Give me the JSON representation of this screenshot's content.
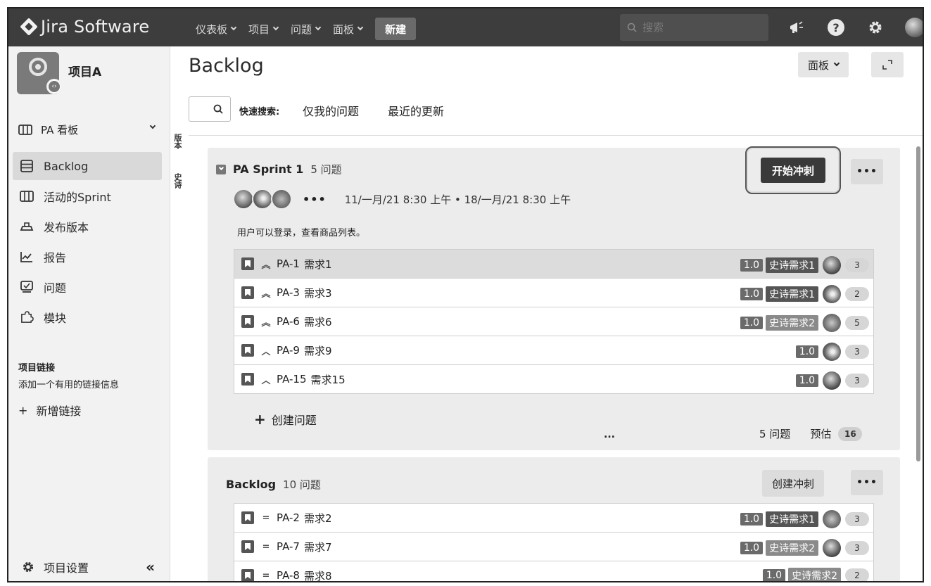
{
  "topbar": {
    "logo_text": "Jira Software",
    "nav": [
      {
        "label": "仪表板"
      },
      {
        "label": "项目"
      },
      {
        "label": "问题"
      },
      {
        "label": "面板"
      }
    ],
    "create_label": "新建",
    "search_placeholder": "搜索",
    "icons": [
      "notifications-icon",
      "help-icon",
      "settings-icon",
      "profile-avatar"
    ]
  },
  "sidebar": {
    "project_name": "项目A",
    "board_selector": "PA 看板",
    "items": [
      {
        "label": "Backlog",
        "icon": "backlog-icon",
        "active": true
      },
      {
        "label": "活动的Sprint",
        "icon": "board-icon",
        "active": false
      },
      {
        "label": "发布版本",
        "icon": "ship-icon",
        "active": false
      },
      {
        "label": "报告",
        "icon": "chart-icon",
        "active": false
      },
      {
        "label": "问题",
        "icon": "issues-icon",
        "active": false
      },
      {
        "label": "模块",
        "icon": "puzzle-icon",
        "active": false
      }
    ],
    "links_title": "项目链接",
    "links_desc": "添加一个有用的链接信息",
    "add_link": "新增链接",
    "settings_label": "项目设置",
    "collapse_label": "«"
  },
  "vtabs": [
    "版本",
    "史诗"
  ],
  "main": {
    "title": "Backlog",
    "board_button": "面板",
    "quick_search_label": "快速搜索:",
    "quick_filters": [
      "仅我的问题",
      "最近的更新"
    ]
  },
  "sprint": {
    "name": "PA Sprint 1",
    "count": "5 问题",
    "more": "•••",
    "dates": "11/一月/21 8:30 上午 • 18/一月/21 8:30 上午",
    "goal": "用户可以登录，查看商品列表。",
    "start_button": "开始冲刺",
    "issues": [
      {
        "key": "PA-1",
        "summary": "需求1",
        "priority": "︽",
        "version": "1.0",
        "epic": "史诗需求1",
        "points": "3"
      },
      {
        "key": "PA-3",
        "summary": "需求3",
        "priority": "︽",
        "version": "1.0",
        "epic": "史诗需求1",
        "points": "2"
      },
      {
        "key": "PA-6",
        "summary": "需求6",
        "priority": "︽",
        "version": "1.0",
        "epic": "史诗需求2",
        "points": "5"
      },
      {
        "key": "PA-9",
        "summary": "需求9",
        "priority": "︿",
        "version": "1.0",
        "epic": "",
        "points": "3"
      },
      {
        "key": "PA-15",
        "summary": "需求15",
        "priority": "︿",
        "version": "1.0",
        "epic": "",
        "points": "3"
      }
    ],
    "create_issue": "创建问题",
    "footer_dots": "...",
    "footer_count": "5 问题",
    "estimate_label": "预估",
    "estimate_value": "16"
  },
  "backlog": {
    "name": "Backlog",
    "count": "10 问题",
    "create_sprint": "创建冲刺",
    "more": "•••",
    "issues": [
      {
        "key": "PA-2",
        "summary": "需求2",
        "priority": "=",
        "version": "1.0",
        "epic": "史诗需求1",
        "points": "3"
      },
      {
        "key": "PA-7",
        "summary": "需求7",
        "priority": "=",
        "version": "1.0",
        "epic": "史诗需求2",
        "points": "3"
      },
      {
        "key": "PA-8",
        "summary": "需求8",
        "priority": "=",
        "version": "1.0",
        "epic": "史诗需求2",
        "points": "2"
      }
    ]
  }
}
